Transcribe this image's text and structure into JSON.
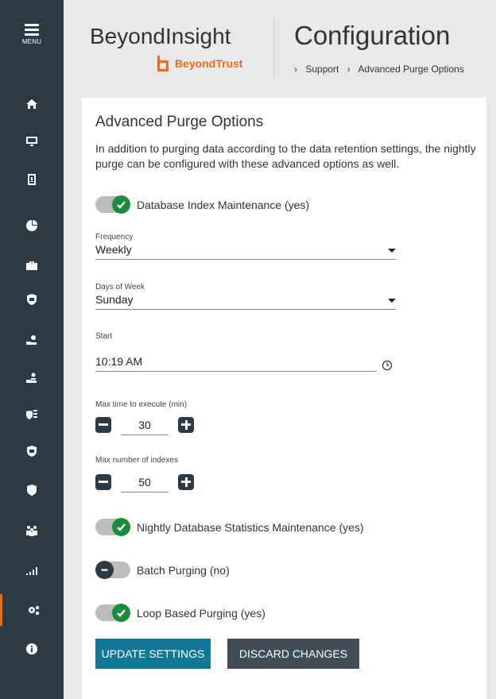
{
  "sidebar": {
    "menu_label": "MENU",
    "items": [
      {
        "icon": "home-icon"
      },
      {
        "icon": "monitor-icon"
      },
      {
        "icon": "badge-icon"
      },
      {
        "icon": "analytics-icon"
      },
      {
        "icon": "briefcase-icon"
      },
      {
        "icon": "shield-device-icon"
      },
      {
        "icon": "hand-gear-icon"
      },
      {
        "icon": "hand-user-icon"
      },
      {
        "icon": "shield-list-icon"
      },
      {
        "icon": "shield-monitor-icon"
      },
      {
        "icon": "shield-key-icon"
      },
      {
        "icon": "users-icon"
      },
      {
        "icon": "bar-chart-icon"
      },
      {
        "icon": "gears-icon",
        "active": true
      },
      {
        "icon": "info-icon"
      }
    ]
  },
  "header": {
    "product": "BeyondInsight",
    "logo_text": "BeyondTrust",
    "page_title": "Configuration",
    "breadcrumb": [
      "Support",
      "Advanced Purge Options"
    ]
  },
  "card": {
    "title": "Advanced Purge Options",
    "description": "In addition to purging data according to the data retention settings, the nightly purge can be configured with these advanced options as well.",
    "index_maintenance": {
      "label": "Database Index Maintenance (yes)",
      "on": true
    },
    "frequency": {
      "label": "Frequency",
      "value": "Weekly"
    },
    "days_of_week": {
      "label": "Days of Week",
      "value": "Sunday"
    },
    "start": {
      "label": "Start",
      "value": "10:19 AM"
    },
    "max_time": {
      "label": "Max time to execute (min)",
      "value": "30"
    },
    "max_indexes": {
      "label": "Max number of indexes",
      "value": "50"
    },
    "stats_maintenance": {
      "label": "Nightly Database Statistics Maintenance (yes)",
      "on": true
    },
    "batch_purging": {
      "label": "Batch Purging (no)",
      "on": false
    },
    "loop_purging": {
      "label": "Loop Based Purging (yes)",
      "on": true
    },
    "update_button": "UPDATE SETTINGS",
    "discard_button": "DISCARD CHANGES"
  },
  "colors": {
    "sidebar": "#2b3a47",
    "accent_orange": "#f06a1a",
    "toggle_on": "#1a8c3a",
    "primary_button": "#127896",
    "secondary_button": "#3f4d59"
  }
}
